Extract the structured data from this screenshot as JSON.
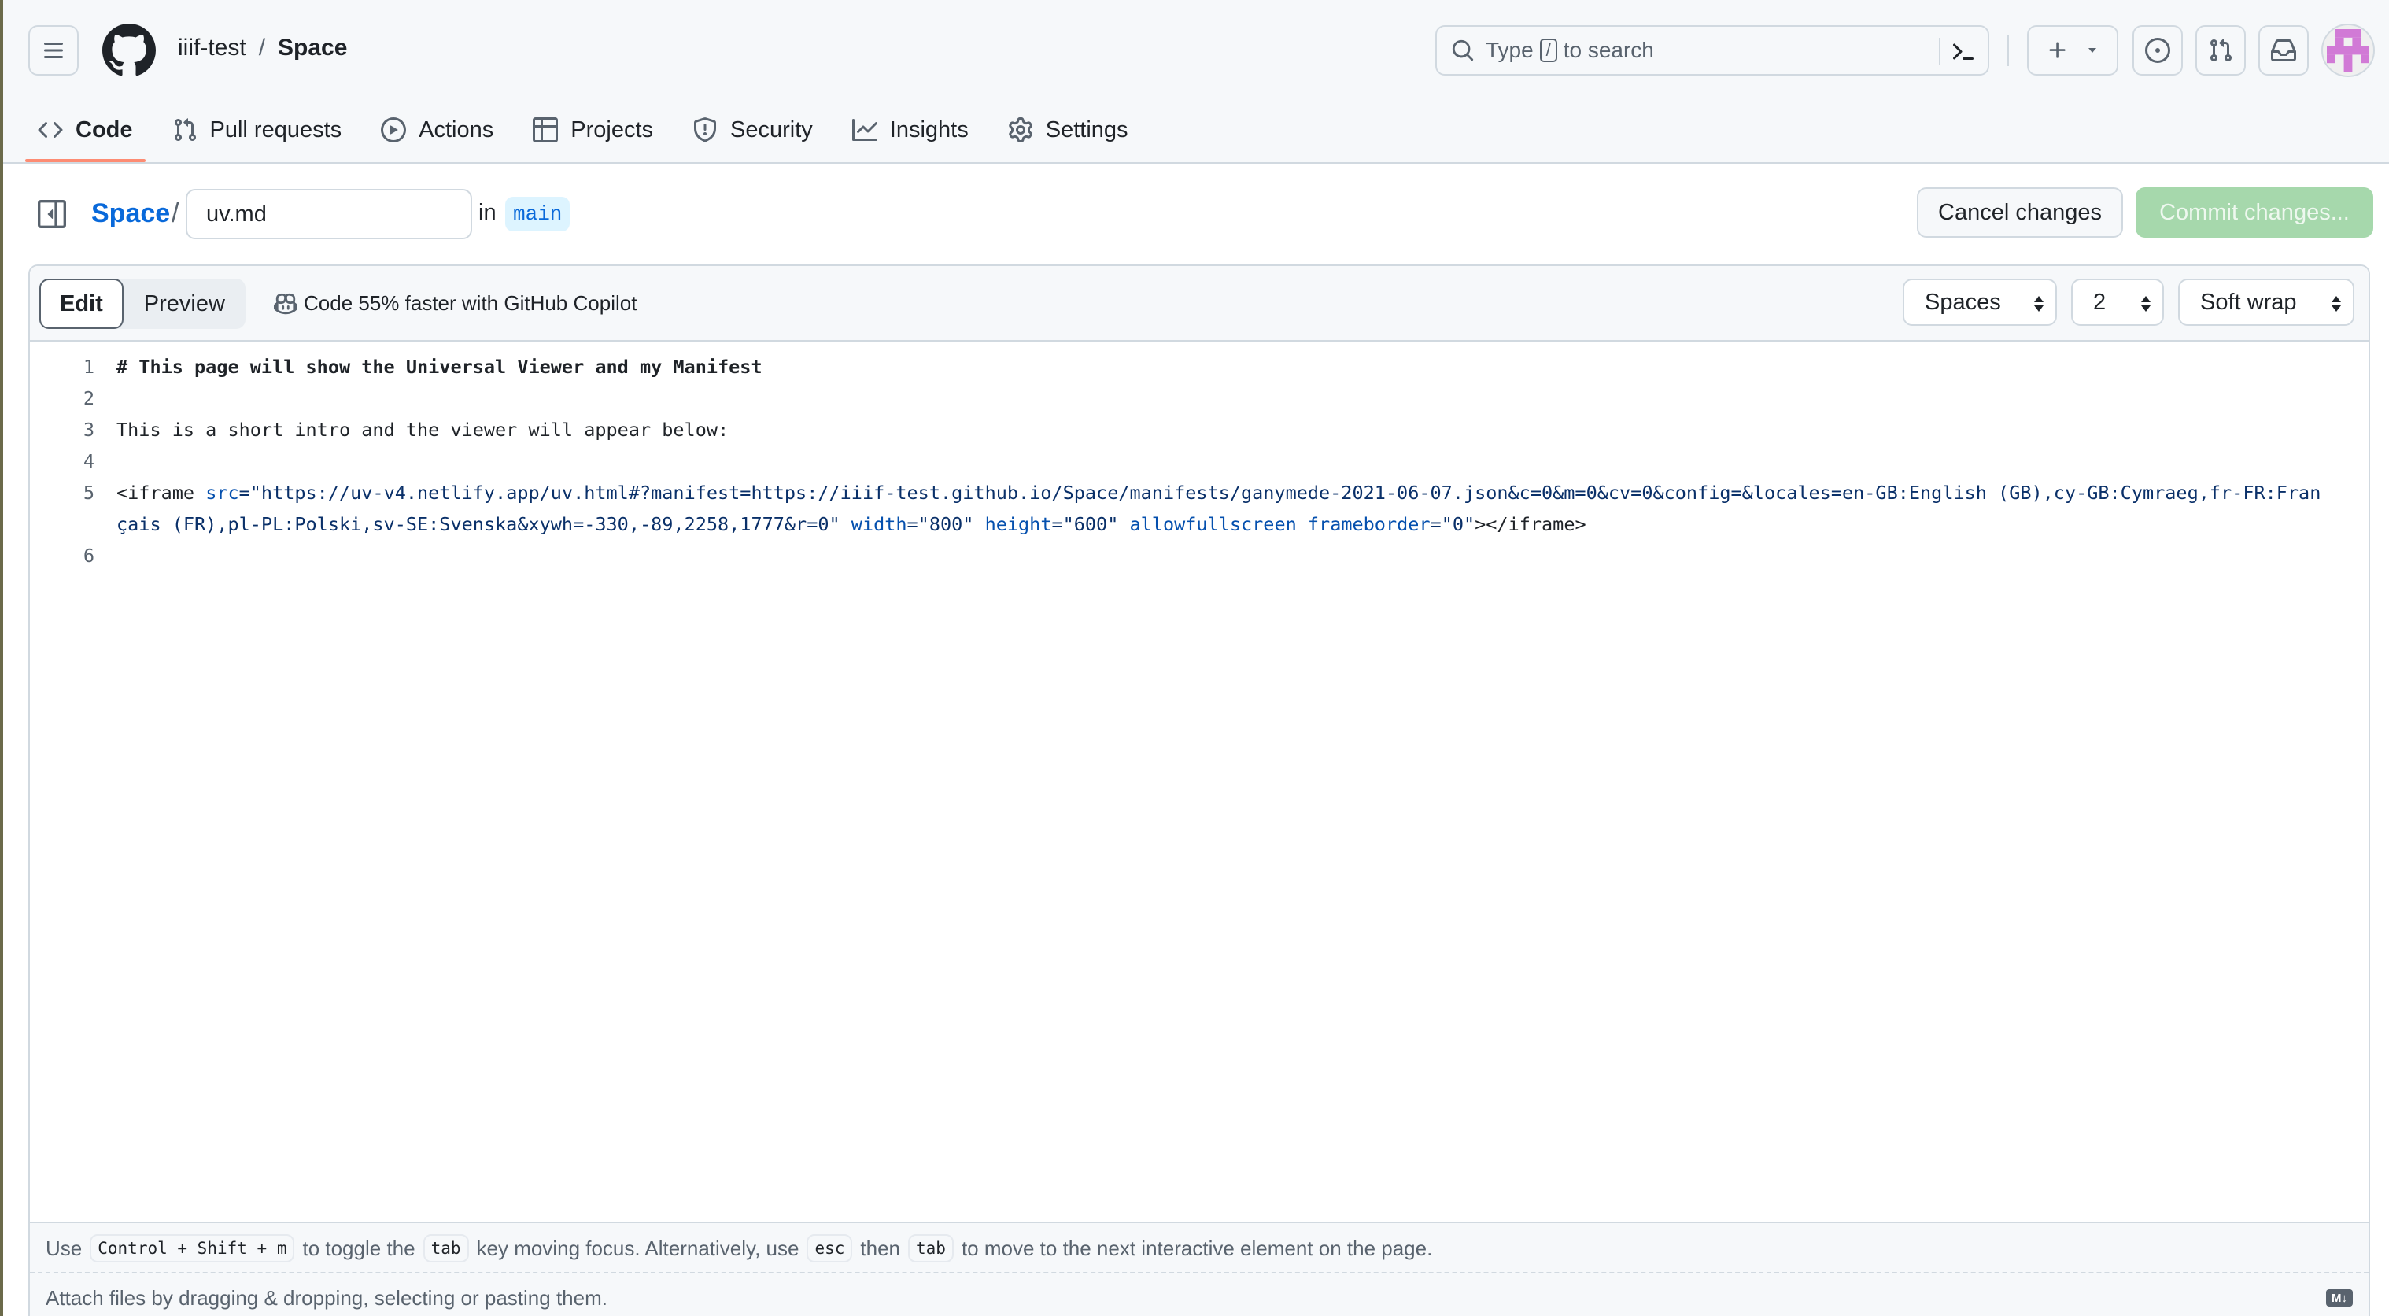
{
  "header": {
    "repo_owner": "iiif-test",
    "repo_separator": "/",
    "repo_name": "Space",
    "search": {
      "prefix": "Type",
      "key": "/",
      "suffix": "to search"
    },
    "avatar_color": "#d17ad6"
  },
  "repo_nav": {
    "items": [
      {
        "label": "Code",
        "icon": "code-icon",
        "active": true
      },
      {
        "label": "Pull requests",
        "icon": "git-pull-request-icon"
      },
      {
        "label": "Actions",
        "icon": "play-icon"
      },
      {
        "label": "Projects",
        "icon": "table-icon"
      },
      {
        "label": "Security",
        "icon": "shield-icon"
      },
      {
        "label": "Insights",
        "icon": "graph-icon"
      },
      {
        "label": "Settings",
        "icon": "gear-icon"
      }
    ],
    "active_underline_color": "#fd8c73"
  },
  "file_bar": {
    "repo_link": "Space",
    "separator": "/",
    "filename": "uv.md",
    "in_label": "in",
    "branch": "main",
    "cancel_label": "Cancel changes",
    "commit_label": "Commit changes..."
  },
  "editor": {
    "tabs": [
      {
        "label": "Edit",
        "active": true
      },
      {
        "label": "Preview",
        "active": false
      }
    ],
    "copilot_text": "Code 55% faster with GitHub Copilot",
    "indent_mode": "Spaces",
    "indent_size": "2",
    "wrap_mode": "Soft wrap",
    "lines": [
      {
        "number": "1",
        "text": "# This page will show the Universal Viewer and my Manifest"
      },
      {
        "number": "2",
        "text": ""
      },
      {
        "number": "3",
        "text": "This is a short intro and the viewer will appear below:"
      },
      {
        "number": "4",
        "text": ""
      },
      {
        "number": "5",
        "tokens": {
          "tag_open": "<iframe ",
          "attr_src": "src",
          "src_value": "=\"https://uv-v4.netlify.app/uv.html#?manifest=https://iiif-test.github.io/Space/manifests/ganymede-2021-06-07.json&c=0&m=0&cv=0&config=&locales=en-GB:English (GB),cy-GB:Cymraeg,fr-FR:Français (FR),pl-PL:Polski,sv-SE:Svenska&xywh=-330,-89,2258,1777&r=0\" ",
          "attr_width": "width",
          "width_value": "=\"800\" ",
          "attr_height": "height",
          "height_value": "=\"600\" ",
          "attr_allowfullscreen": "allowfullscreen",
          "space": " ",
          "attr_frameborder": "frameborder",
          "frameborder_value": "=\"0\"",
          "tag_close": "></iframe>"
        }
      },
      {
        "number": "6",
        "text": ""
      }
    ]
  },
  "footer": {
    "hint": {
      "use": "Use",
      "shortcut": "Control + Shift + m",
      "toggle_text": "to toggle the",
      "tab_key": "tab",
      "moving_text": "key moving focus. Alternatively, use",
      "esc_key": "esc",
      "then_text": "then",
      "tab_key_2": "tab",
      "end_text": "to move to the next interactive element on the page."
    },
    "attach_text": "Attach files by dragging & dropping, selecting or pasting them.",
    "markdown_badge": "M↓"
  }
}
